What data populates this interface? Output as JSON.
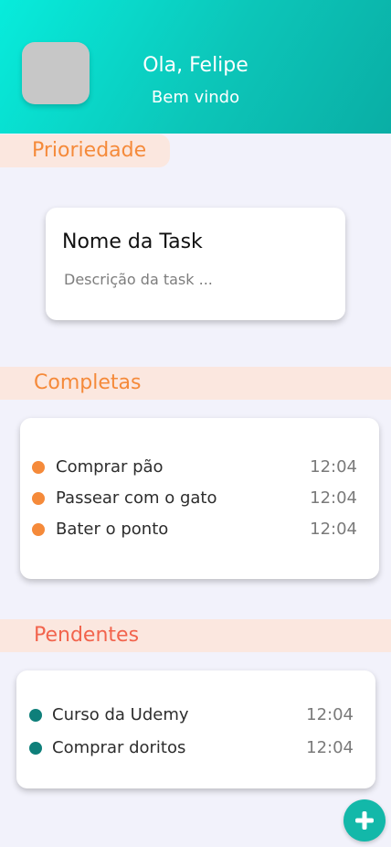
{
  "header": {
    "greeting": "Ola, Felipe",
    "welcome": "Bem vindo"
  },
  "sections": {
    "priority": {
      "label": "Prioriedade",
      "task_name": "Nome da Task",
      "task_description": "Descrição da task ..."
    },
    "completed": {
      "label": "Completas",
      "items": [
        {
          "text": "Comprar pão",
          "time": "12:04"
        },
        {
          "text": "Passear com o gato",
          "time": "12:04"
        },
        {
          "text": "Bater o ponto",
          "time": "12:04"
        }
      ]
    },
    "pending": {
      "label": "Pendentes",
      "items": [
        {
          "text": "Curso da Udemy",
          "time": "12:04"
        },
        {
          "text": "Comprar doritos",
          "time": "12:04"
        }
      ]
    }
  },
  "fab": {
    "icon": "plus-icon"
  },
  "colors": {
    "header_start": "#07ecdc",
    "header_end": "#0aaea5",
    "completed_accent": "#f58a3a",
    "pending_accent": "#f2644d",
    "pending_dot": "#0e7f7a",
    "fab": "#13b8a9"
  }
}
